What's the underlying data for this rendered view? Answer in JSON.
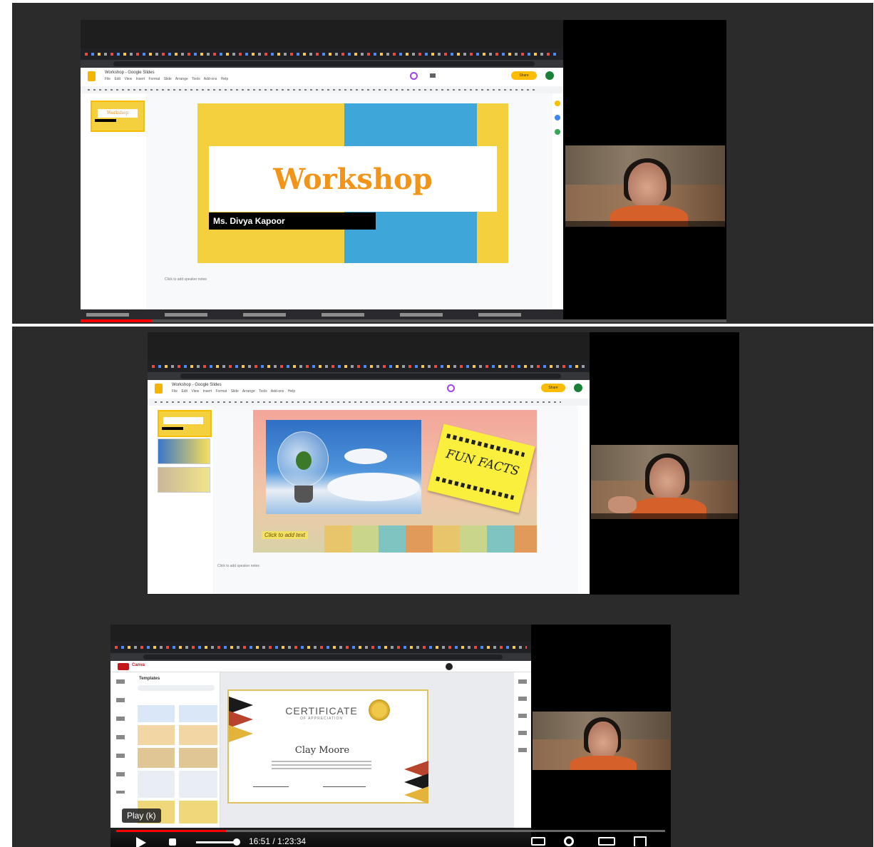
{
  "panel1": {
    "doc_title": "Workshop - Google Slides",
    "menus": "File Edit View Insert Format Slide Arrange Tools Add-ons Help",
    "share_label": "Share",
    "slide_title": "Workshop",
    "slide_presenter": "Ms. Divya Kapoor",
    "thumb_label": "Workshop",
    "notes_placeholder": "Click to add speaker notes"
  },
  "panel2": {
    "doc_title": "Workshop - Google Slides",
    "menus": "File Edit View Insert Format Slide Arrange Tools Add-ons Help",
    "share_label": "Share",
    "note_text": "FUN FACTS",
    "add_text": "Click to add text",
    "notes_placeholder": "Click to add speaker notes"
  },
  "panel3": {
    "app_name": "Canva",
    "templates_heading": "Templates",
    "certificate_title": "CERTIFICATE",
    "certificate_subtitle": "OF APPRECIATION",
    "recipient_name": "Clay Moore",
    "play_tooltip": "Play (k)",
    "time_display": "16:51 / 1:23:34"
  },
  "colors": {
    "slides_yellow": "#f4d03f",
    "slides_blue": "#3ea6d8",
    "workshop_orange": "#f29418",
    "progress_red": "#ff0000"
  },
  "progress": {
    "panel1_played_fraction": 0.11,
    "panel3_played_fraction": 0.2
  }
}
